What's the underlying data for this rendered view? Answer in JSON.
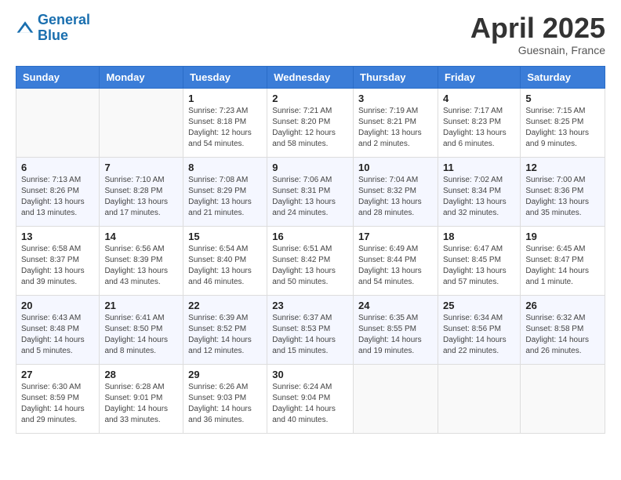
{
  "header": {
    "logo_line1": "General",
    "logo_line2": "Blue",
    "month": "April 2025",
    "location": "Guesnain, France"
  },
  "weekdays": [
    "Sunday",
    "Monday",
    "Tuesday",
    "Wednesday",
    "Thursday",
    "Friday",
    "Saturday"
  ],
  "weeks": [
    [
      {
        "day": "",
        "info": ""
      },
      {
        "day": "",
        "info": ""
      },
      {
        "day": "1",
        "info": "Sunrise: 7:23 AM\nSunset: 8:18 PM\nDaylight: 12 hours and 54 minutes."
      },
      {
        "day": "2",
        "info": "Sunrise: 7:21 AM\nSunset: 8:20 PM\nDaylight: 12 hours and 58 minutes."
      },
      {
        "day": "3",
        "info": "Sunrise: 7:19 AM\nSunset: 8:21 PM\nDaylight: 13 hours and 2 minutes."
      },
      {
        "day": "4",
        "info": "Sunrise: 7:17 AM\nSunset: 8:23 PM\nDaylight: 13 hours and 6 minutes."
      },
      {
        "day": "5",
        "info": "Sunrise: 7:15 AM\nSunset: 8:25 PM\nDaylight: 13 hours and 9 minutes."
      }
    ],
    [
      {
        "day": "6",
        "info": "Sunrise: 7:13 AM\nSunset: 8:26 PM\nDaylight: 13 hours and 13 minutes."
      },
      {
        "day": "7",
        "info": "Sunrise: 7:10 AM\nSunset: 8:28 PM\nDaylight: 13 hours and 17 minutes."
      },
      {
        "day": "8",
        "info": "Sunrise: 7:08 AM\nSunset: 8:29 PM\nDaylight: 13 hours and 21 minutes."
      },
      {
        "day": "9",
        "info": "Sunrise: 7:06 AM\nSunset: 8:31 PM\nDaylight: 13 hours and 24 minutes."
      },
      {
        "day": "10",
        "info": "Sunrise: 7:04 AM\nSunset: 8:32 PM\nDaylight: 13 hours and 28 minutes."
      },
      {
        "day": "11",
        "info": "Sunrise: 7:02 AM\nSunset: 8:34 PM\nDaylight: 13 hours and 32 minutes."
      },
      {
        "day": "12",
        "info": "Sunrise: 7:00 AM\nSunset: 8:36 PM\nDaylight: 13 hours and 35 minutes."
      }
    ],
    [
      {
        "day": "13",
        "info": "Sunrise: 6:58 AM\nSunset: 8:37 PM\nDaylight: 13 hours and 39 minutes."
      },
      {
        "day": "14",
        "info": "Sunrise: 6:56 AM\nSunset: 8:39 PM\nDaylight: 13 hours and 43 minutes."
      },
      {
        "day": "15",
        "info": "Sunrise: 6:54 AM\nSunset: 8:40 PM\nDaylight: 13 hours and 46 minutes."
      },
      {
        "day": "16",
        "info": "Sunrise: 6:51 AM\nSunset: 8:42 PM\nDaylight: 13 hours and 50 minutes."
      },
      {
        "day": "17",
        "info": "Sunrise: 6:49 AM\nSunset: 8:44 PM\nDaylight: 13 hours and 54 minutes."
      },
      {
        "day": "18",
        "info": "Sunrise: 6:47 AM\nSunset: 8:45 PM\nDaylight: 13 hours and 57 minutes."
      },
      {
        "day": "19",
        "info": "Sunrise: 6:45 AM\nSunset: 8:47 PM\nDaylight: 14 hours and 1 minute."
      }
    ],
    [
      {
        "day": "20",
        "info": "Sunrise: 6:43 AM\nSunset: 8:48 PM\nDaylight: 14 hours and 5 minutes."
      },
      {
        "day": "21",
        "info": "Sunrise: 6:41 AM\nSunset: 8:50 PM\nDaylight: 14 hours and 8 minutes."
      },
      {
        "day": "22",
        "info": "Sunrise: 6:39 AM\nSunset: 8:52 PM\nDaylight: 14 hours and 12 minutes."
      },
      {
        "day": "23",
        "info": "Sunrise: 6:37 AM\nSunset: 8:53 PM\nDaylight: 14 hours and 15 minutes."
      },
      {
        "day": "24",
        "info": "Sunrise: 6:35 AM\nSunset: 8:55 PM\nDaylight: 14 hours and 19 minutes."
      },
      {
        "day": "25",
        "info": "Sunrise: 6:34 AM\nSunset: 8:56 PM\nDaylight: 14 hours and 22 minutes."
      },
      {
        "day": "26",
        "info": "Sunrise: 6:32 AM\nSunset: 8:58 PM\nDaylight: 14 hours and 26 minutes."
      }
    ],
    [
      {
        "day": "27",
        "info": "Sunrise: 6:30 AM\nSunset: 8:59 PM\nDaylight: 14 hours and 29 minutes."
      },
      {
        "day": "28",
        "info": "Sunrise: 6:28 AM\nSunset: 9:01 PM\nDaylight: 14 hours and 33 minutes."
      },
      {
        "day": "29",
        "info": "Sunrise: 6:26 AM\nSunset: 9:03 PM\nDaylight: 14 hours and 36 minutes."
      },
      {
        "day": "30",
        "info": "Sunrise: 6:24 AM\nSunset: 9:04 PM\nDaylight: 14 hours and 40 minutes."
      },
      {
        "day": "",
        "info": ""
      },
      {
        "day": "",
        "info": ""
      },
      {
        "day": "",
        "info": ""
      }
    ]
  ]
}
